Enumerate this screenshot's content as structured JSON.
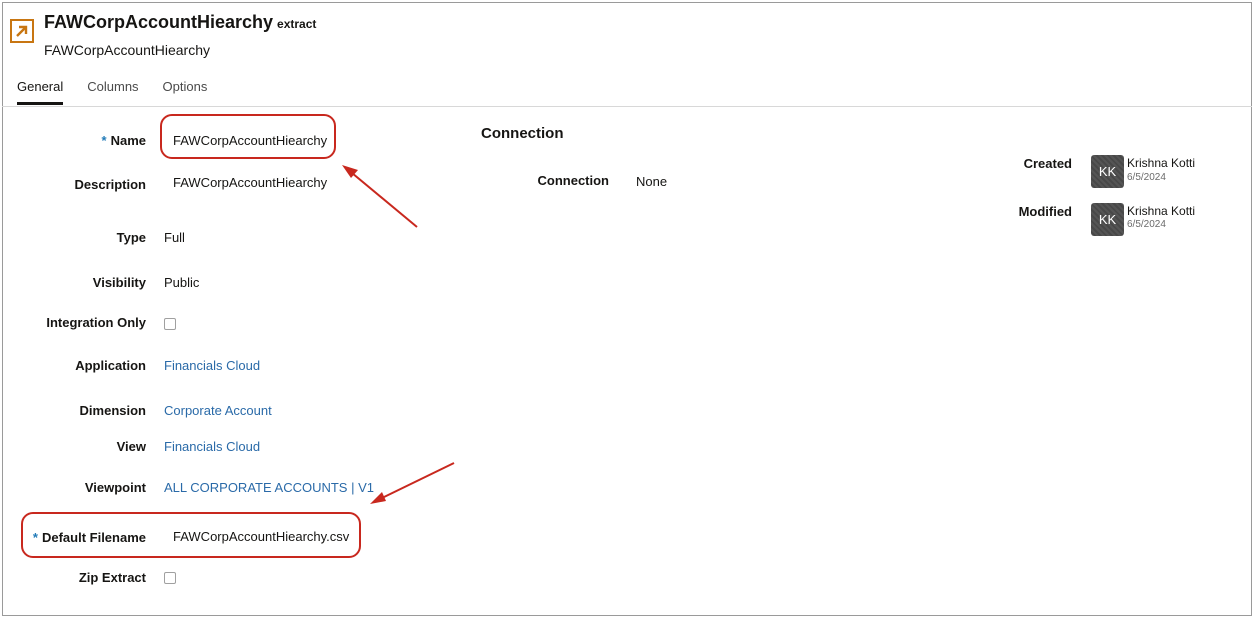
{
  "header": {
    "icon": "extract-arrow-icon",
    "title": "FAWCorpAccountHiearchy",
    "title_suffix": "extract",
    "subtitle": "FAWCorpAccountHiearchy"
  },
  "tabs": [
    {
      "label": "General",
      "active": true
    },
    {
      "label": "Columns",
      "active": false
    },
    {
      "label": "Options",
      "active": false
    }
  ],
  "form": {
    "required_marker": "*",
    "name": {
      "label": "Name",
      "value": "FAWCorpAccountHiearchy"
    },
    "description": {
      "label": "Description",
      "value": "FAWCorpAccountHiearchy"
    },
    "type": {
      "label": "Type",
      "value": "Full"
    },
    "visibility": {
      "label": "Visibility",
      "value": "Public"
    },
    "integration_only": {
      "label": "Integration Only",
      "checked": false
    },
    "application": {
      "label": "Application",
      "value": "Financials Cloud"
    },
    "dimension": {
      "label": "Dimension",
      "value": "Corporate Account"
    },
    "view": {
      "label": "View",
      "value": "Financials Cloud"
    },
    "viewpoint": {
      "label": "Viewpoint",
      "value": "ALL CORPORATE ACCOUNTS | V1"
    },
    "default_filename": {
      "label": "Default Filename",
      "value": "FAWCorpAccountHiearchy.csv"
    },
    "zip_extract": {
      "label": "Zip Extract",
      "checked": false
    }
  },
  "connection": {
    "section_title": "Connection",
    "label": "Connection",
    "value": "None"
  },
  "audit": {
    "created": {
      "label": "Created",
      "initials": "KK",
      "name": "Krishna Kotti",
      "date": "6/5/2024"
    },
    "modified": {
      "label": "Modified",
      "initials": "KK",
      "name": "Krishna Kotti",
      "date": "6/5/2024"
    }
  },
  "colors": {
    "accent_orange": "#c87612",
    "link_blue": "#2a6aa8",
    "required_blue": "#227bb8",
    "annotation_red": "#c8281e"
  }
}
